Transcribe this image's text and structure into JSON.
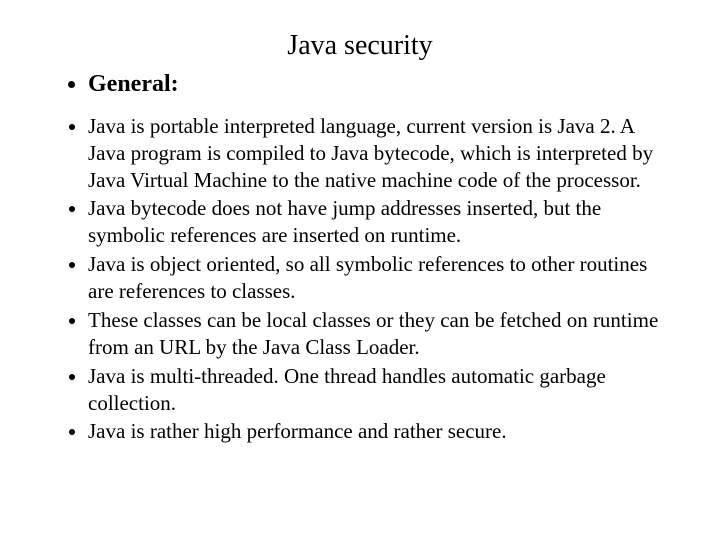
{
  "title": "Java security",
  "heading": "General:",
  "bullets": {
    "b0": "Java is portable interpreted language, current version is Java 2. A Java program is compiled to Java bytecode, which is interpreted by Java Virtual Machine to the native machine code of the processor.",
    "b1": "Java bytecode does not have jump addresses inserted, but the symbolic references are inserted on runtime.",
    "b2": "Java is object oriented, so all symbolic references to other routines are references to classes.",
    "b3": "These classes can be local classes or they can be fetched on runtime from an URL by the Java Class Loader.",
    "b4": "Java is multi-threaded. One thread handles automatic garbage collection.",
    "b5": "Java is rather high performance and rather secure."
  }
}
